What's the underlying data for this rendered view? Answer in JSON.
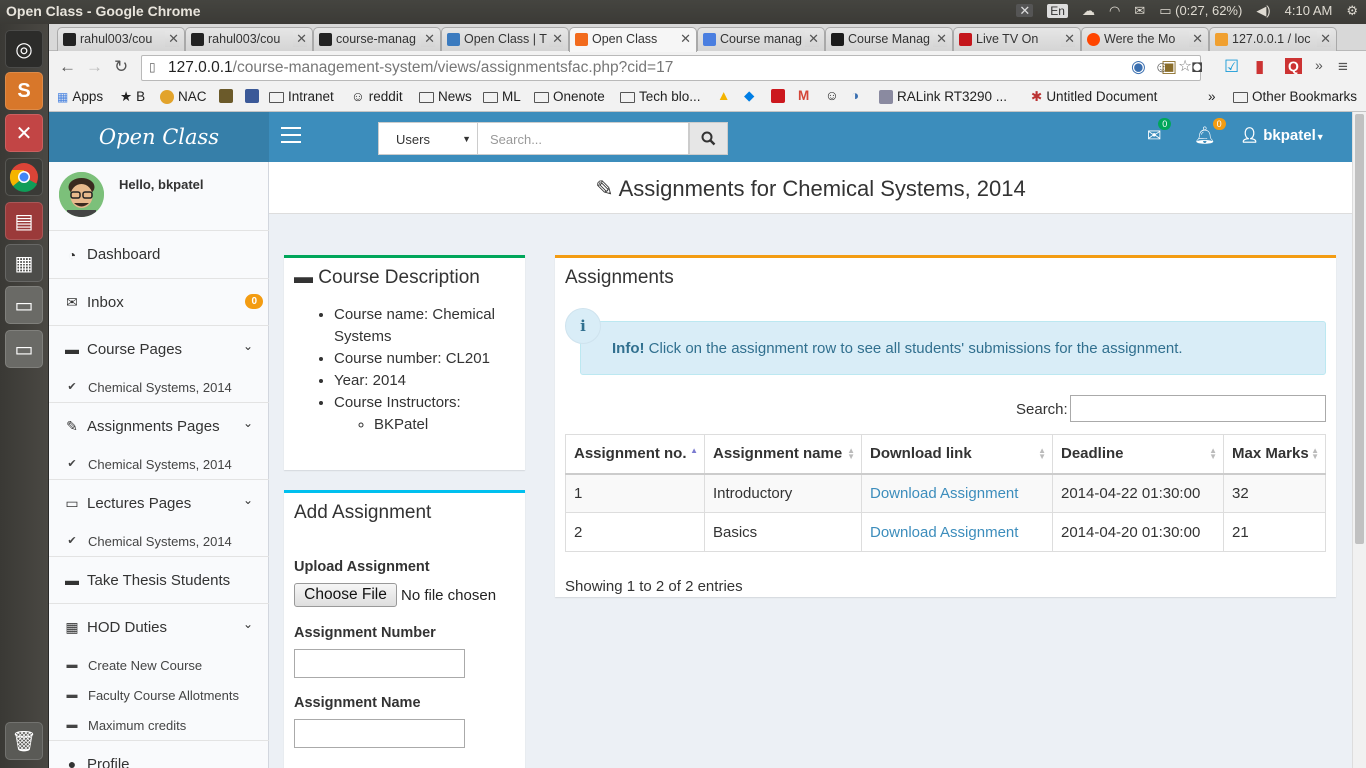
{
  "os": {
    "window_title": "Open Class - Google Chrome",
    "lang": "En",
    "battery": "(0:27, 62%)",
    "clock": "4:10 AM"
  },
  "browser": {
    "tabs": [
      {
        "label": "rahul003/cou",
        "favcolor": "#222222"
      },
      {
        "label": "rahul003/cou",
        "favcolor": "#222222"
      },
      {
        "label": "course-manag",
        "favcolor": "#222222"
      },
      {
        "label": "Open Class | T",
        "favcolor": "#3b7bbf"
      },
      {
        "label": "Open Class",
        "favcolor": "#f26b1d"
      },
      {
        "label": "Course manag",
        "favcolor": "#4a7ee0"
      },
      {
        "label": "Course Manag",
        "favcolor": "#1a1a1a"
      },
      {
        "label": "Live TV On",
        "favcolor": "#c4161c"
      },
      {
        "label": "Were the Mo",
        "favcolor": "#ff4500"
      },
      {
        "label": "127.0.0.1 / loc",
        "favcolor": "#f0a030"
      }
    ],
    "url_host": "127.0.0.1",
    "url_path": "/course-management-system/views/assignmentsfac.php?cid=17",
    "bookmarks": {
      "apps": "Apps",
      "b": "B",
      "nac": "NAC",
      "intranet": "Intranet",
      "reddit": "reddit",
      "news": "News",
      "ml": "ML",
      "onenote": "Onenote",
      "techblog": "Tech blo...",
      "ralink": "RALink RT3290 ...",
      "untitled": "Untitled Document",
      "more": "»",
      "other": "Other Bookmarks"
    }
  },
  "app": {
    "logo": "Open Class",
    "search_select": "Users",
    "search_placeholder": "Search...",
    "mail_count": "0",
    "notif_count": "0",
    "username": "bkpatel",
    "accent": "#3c8dbc"
  },
  "sidebar": {
    "hello": "Hello, bkpatel",
    "dashboard": "Dashboard",
    "inbox": "Inbox",
    "inbox_count": "0",
    "course_pages": "Course Pages",
    "course_sub": "Chemical Systems, 2014",
    "assignments_pages": "Assignments Pages",
    "assignments_sub": "Chemical Systems, 2014",
    "lectures_pages": "Lectures Pages",
    "lectures_sub": "Chemical Systems, 2014",
    "thesis": "Take Thesis Students",
    "hod": "HOD Duties",
    "hod_create": "Create New Course",
    "hod_allot": "Faculty Course Allotments",
    "hod_credits": "Maximum credits",
    "profile": "Profile"
  },
  "main": {
    "title": "Assignments for Chemical Systems, 2014",
    "course_desc": {
      "heading": "Course Description",
      "name": "Course name: Chemical Systems",
      "number": "Course number: CL201",
      "year": "Year: 2014",
      "instructors_label": "Course Instructors:",
      "instructor": "BKPatel"
    },
    "add_assignment": {
      "heading": "Add Assignment",
      "upload_label": "Upload Assignment",
      "choose_file": "Choose File",
      "no_file": "No file chosen",
      "number_label": "Assignment Number",
      "name_label": "Assignment Name"
    },
    "assignments": {
      "heading": "Assignments",
      "info_strong": "Info!",
      "info_text": " Click on the assignment row to see all students' submissions for the assignment.",
      "search_label": "Search:",
      "columns": [
        "Assignment no.",
        "Assignment name",
        "Download link",
        "Deadline",
        "Max Marks"
      ],
      "rows": [
        [
          "1",
          "Introductory",
          "Download Assignment",
          "2014-04-22 01:30:00",
          "32"
        ],
        [
          "2",
          "Basics",
          "Download Assignment",
          "2014-04-20 01:30:00",
          "21"
        ]
      ],
      "footer": "Showing 1 to 2 of 2 entries"
    }
  }
}
